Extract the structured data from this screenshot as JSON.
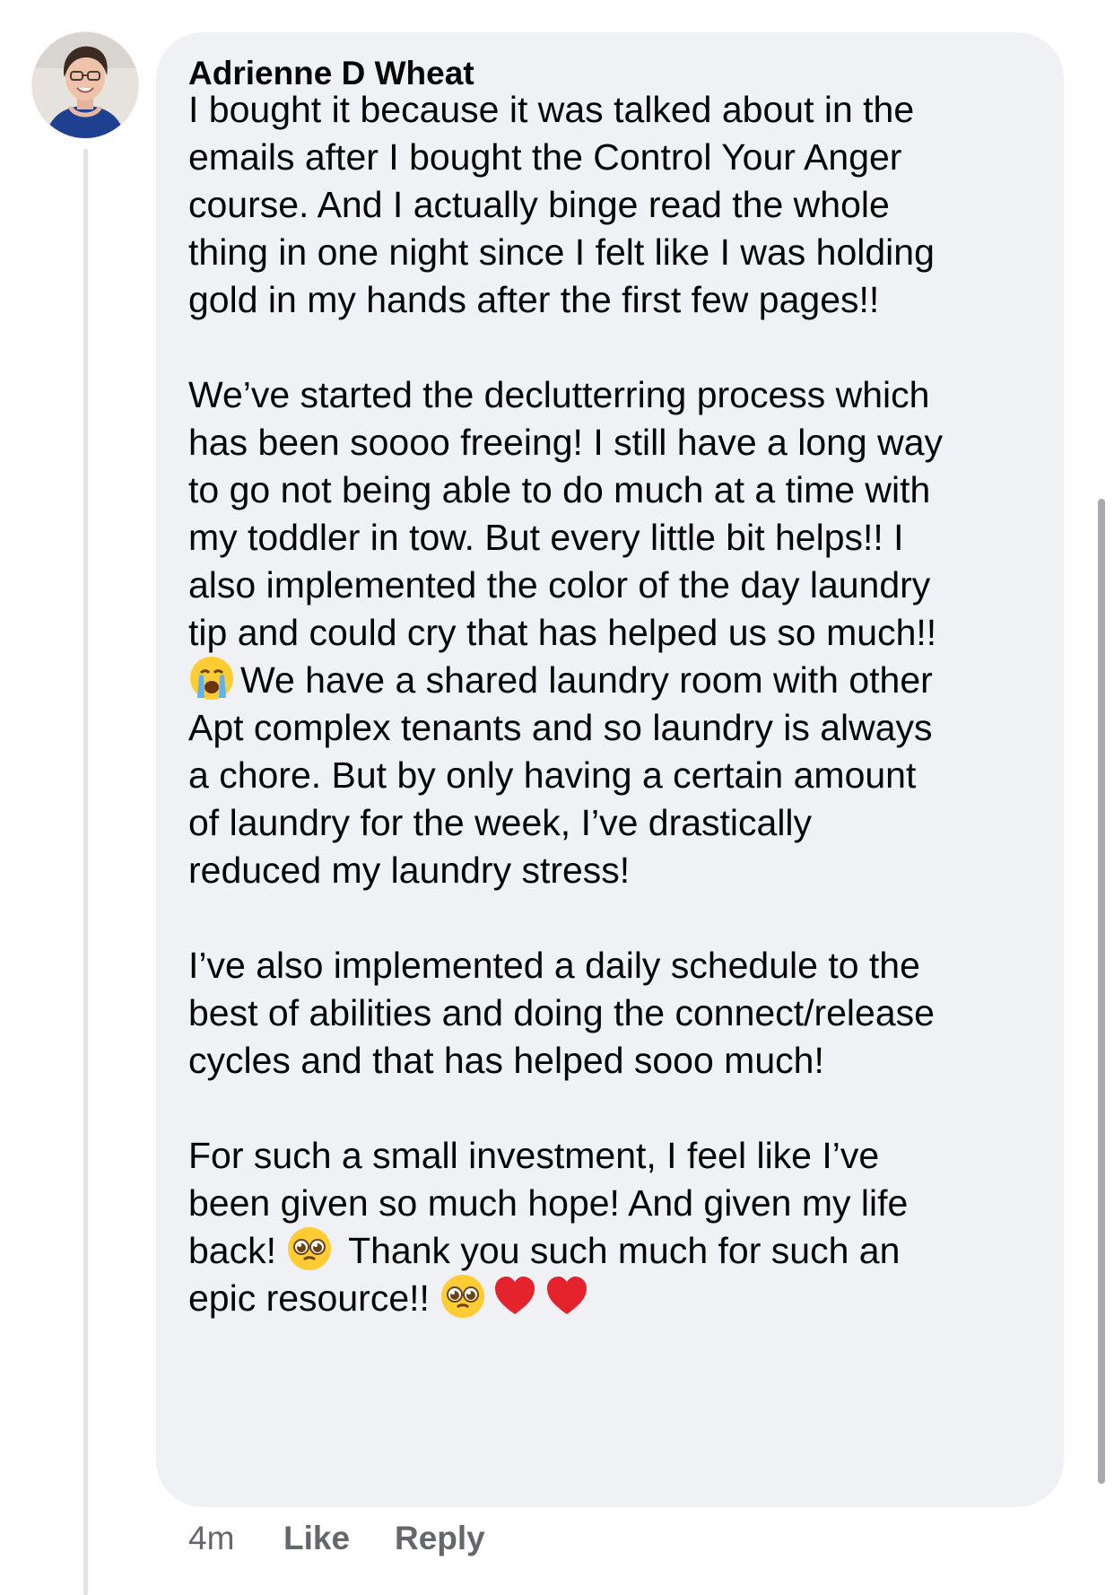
{
  "comment": {
    "author": "Adrienne D Wheat",
    "lines": [
      "I bought it because it was talked about in the",
      "emails after I bought the Control Your Anger",
      "course. And I actually binge read the whole",
      "thing in one night since I felt like I was holding",
      "gold in my hands after the first few pages!!",
      "We’ve started the declutterring process which",
      "has been soooo freeing! I still have a long way",
      "to go not being able to do much at a time with",
      "my toddler in tow. But every little bit helps!! I",
      "also implemented the color of the day laundry",
      "tip and could cry that has helped us so much!!",
      "We have a shared laundry room with other",
      "Apt complex tenants and so laundry is always",
      "a chore. But by only having a certain amount",
      "of laundry for the week, I’ve drastically",
      "reduced my laundry stress!",
      "I’ve also implemented a daily schedule to the",
      "best of abilities and doing the connect/release",
      "cycles and that has helped sooo much!",
      "For such a small investment, I feel like I’ve",
      "been given so much hope! And given my life",
      "back!",
      "Thank you such much for such an",
      "epic resource!!"
    ],
    "emojis": [
      "loudly-crying-face-icon",
      "pleading-face-icon",
      "red-heart-icon"
    ]
  },
  "actions": {
    "time": "4m",
    "like": "Like",
    "reply": "Reply"
  }
}
